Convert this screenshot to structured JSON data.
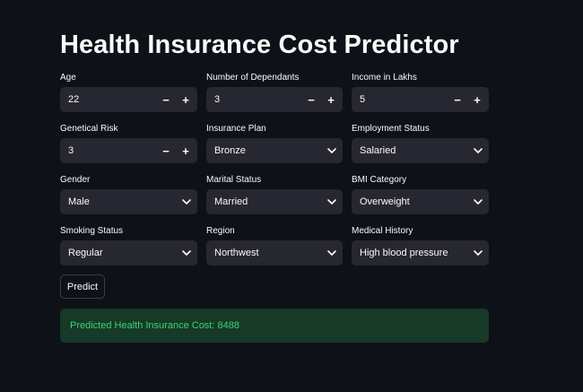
{
  "title": "Health Insurance Cost Predictor",
  "fields": {
    "age": {
      "label": "Age",
      "value": "22"
    },
    "dependants": {
      "label": "Number of Dependants",
      "value": "3"
    },
    "income": {
      "label": "Income in Lakhs",
      "value": "5"
    },
    "genetical_risk": {
      "label": "Genetical Risk",
      "value": "3"
    },
    "insurance_plan": {
      "label": "Insurance Plan",
      "value": "Bronze"
    },
    "employment_status": {
      "label": "Employment Status",
      "value": "Salaried"
    },
    "gender": {
      "label": "Gender",
      "value": "Male"
    },
    "marital_status": {
      "label": "Marital Status",
      "value": "Married"
    },
    "bmi_category": {
      "label": "BMI Category",
      "value": "Overweight"
    },
    "smoking_status": {
      "label": "Smoking Status",
      "value": "Regular"
    },
    "region": {
      "label": "Region",
      "value": "Northwest"
    },
    "medical_history": {
      "label": "Medical History",
      "value": "High blood pressure"
    }
  },
  "stepper": {
    "minus": "−",
    "plus": "+"
  },
  "predict_label": "Predict",
  "result_text": "Predicted Health Insurance Cost: 8488",
  "colors": {
    "background": "#0e1117",
    "input_bg": "#262730",
    "success_bg": "#173928",
    "success_text": "#3dd56d"
  },
  "icons": {
    "stepper_minus": "minus-icon",
    "stepper_plus": "plus-icon",
    "select_open": "chevron-down-icon"
  }
}
